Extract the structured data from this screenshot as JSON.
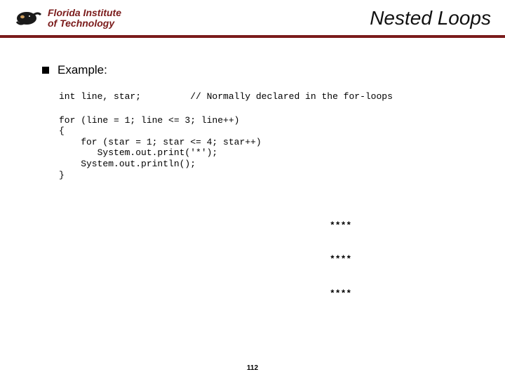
{
  "header": {
    "logo_line1": "Florida Institute",
    "logo_line2": "of Technology",
    "title": "Nested Loops"
  },
  "bullet": {
    "label": "Example:"
  },
  "code": {
    "l1": "int line, star;         // Normally declared in the for-loops",
    "l2": "for (line = 1; line <= 3; line++)",
    "l3": "{",
    "l4": "    for (star = 1; star <= 4; star++)",
    "l5": "       System.out.print('*');",
    "l6": "    System.out.println();",
    "l7": "}"
  },
  "output": {
    "o1": "****",
    "o2": "****",
    "o3": "****"
  },
  "page": {
    "number": "112"
  }
}
